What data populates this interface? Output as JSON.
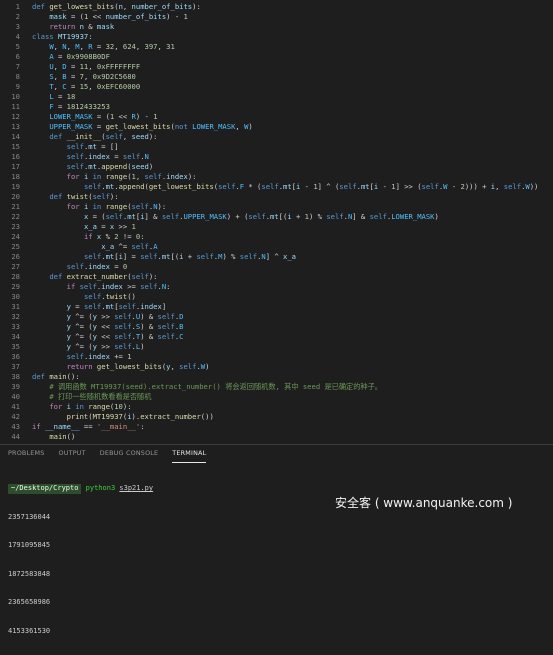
{
  "editor": {
    "lines": [
      {
        "n": "1",
        "code": "def get_lowest_bits(n, number_of_bits):"
      },
      {
        "n": "2",
        "code": "    mask = (1 << number_of_bits) - 1"
      },
      {
        "n": "3",
        "code": "    return n & mask"
      },
      {
        "n": "4",
        "code": "class MT19937:"
      },
      {
        "n": "5",
        "code": "    W, N, M, R = 32, 624, 397, 31"
      },
      {
        "n": "6",
        "code": "    A = 0x9908B0DF"
      },
      {
        "n": "7",
        "code": "    U, D = 11, 0xFFFFFFFF"
      },
      {
        "n": "8",
        "code": "    S, B = 7, 0x9D2C5680"
      },
      {
        "n": "9",
        "code": "    T, C = 15, 0xEFC60000"
      },
      {
        "n": "10",
        "code": "    L = 18"
      },
      {
        "n": "11",
        "code": "    F = 1812433253"
      },
      {
        "n": "12",
        "code": "    LOWER_MASK = (1 << R) - 1"
      },
      {
        "n": "13",
        "code": "    UPPER_MASK = get_lowest_bits(not LOWER_MASK, W)"
      },
      {
        "n": "14",
        "code": "    def __init__(self, seed):"
      },
      {
        "n": "15",
        "code": "        self.mt = []"
      },
      {
        "n": "16",
        "code": "        self.index = self.N"
      },
      {
        "n": "17",
        "code": "        self.mt.append(seed)"
      },
      {
        "n": "18",
        "code": "        for i in range(1, self.index):"
      },
      {
        "n": "19",
        "code": "            self.mt.append(get_lowest_bits(self.F * (self.mt[i - 1] ^ (self.mt[i - 1] >> (self.W - 2))) + i, self.W))"
      },
      {
        "n": "20",
        "code": "    def twist(self):"
      },
      {
        "n": "21",
        "code": "        for i in range(self.N):"
      },
      {
        "n": "22",
        "code": "            x = (self.mt[i] & self.UPPER_MASK) + (self.mt[(i + 1) % self.N] & self.LOWER_MASK)"
      },
      {
        "n": "23",
        "code": "            x_a = x >> 1"
      },
      {
        "n": "24",
        "code": "            if x % 2 != 0:"
      },
      {
        "n": "25",
        "code": "                x_a ^= self.A"
      },
      {
        "n": "26",
        "code": "            self.mt[i] = self.mt[(i + self.M) % self.N] ^ x_a"
      },
      {
        "n": "27",
        "code": "        self.index = 0"
      },
      {
        "n": "28",
        "code": "    def extract_number(self):"
      },
      {
        "n": "29",
        "code": "        if self.index >= self.N:"
      },
      {
        "n": "30",
        "code": "            self.twist()"
      },
      {
        "n": "31",
        "code": "        y = self.mt[self.index]"
      },
      {
        "n": "32",
        "code": "        y ^= (y >> self.U) & self.D"
      },
      {
        "n": "33",
        "code": "        y ^= (y << self.S) & self.B"
      },
      {
        "n": "34",
        "code": "        y ^= (y << self.T) & self.C"
      },
      {
        "n": "35",
        "code": "        y ^= (y >> self.L)"
      },
      {
        "n": "36",
        "code": "        self.index += 1"
      },
      {
        "n": "37",
        "code": "        return get_lowest_bits(y, self.W)"
      },
      {
        "n": "38",
        "code": "def main():"
      },
      {
        "n": "39",
        "code": "    # 调用函数 MT19937(seed).extract_number() 将会返回随机数, 其中 seed 是已确定的种子。"
      },
      {
        "n": "40",
        "code": "    # 打印一些随机数看看是否随机"
      },
      {
        "n": "41",
        "code": "    for i in range(10):"
      },
      {
        "n": "42",
        "code": "        print(MT19937(i).extract_number())"
      },
      {
        "n": "43",
        "code": "if __name__ == '__main__':"
      },
      {
        "n": "44",
        "code": "    main()"
      }
    ]
  },
  "panel": {
    "tabs": [
      "PROBLEMS",
      "OUTPUT",
      "DEBUG CONSOLE",
      "TERMINAL"
    ],
    "active_tab": "TERMINAL",
    "prompt_path": "~/Desktop/Crypto",
    "command": "python3",
    "command_arg": "s3p21.py",
    "output": [
      "2357136044",
      "1791095845",
      "1872583848",
      "2365658986",
      "4153361530"
    ]
  },
  "watermark": "安全客 ( www.anquanke.com )"
}
